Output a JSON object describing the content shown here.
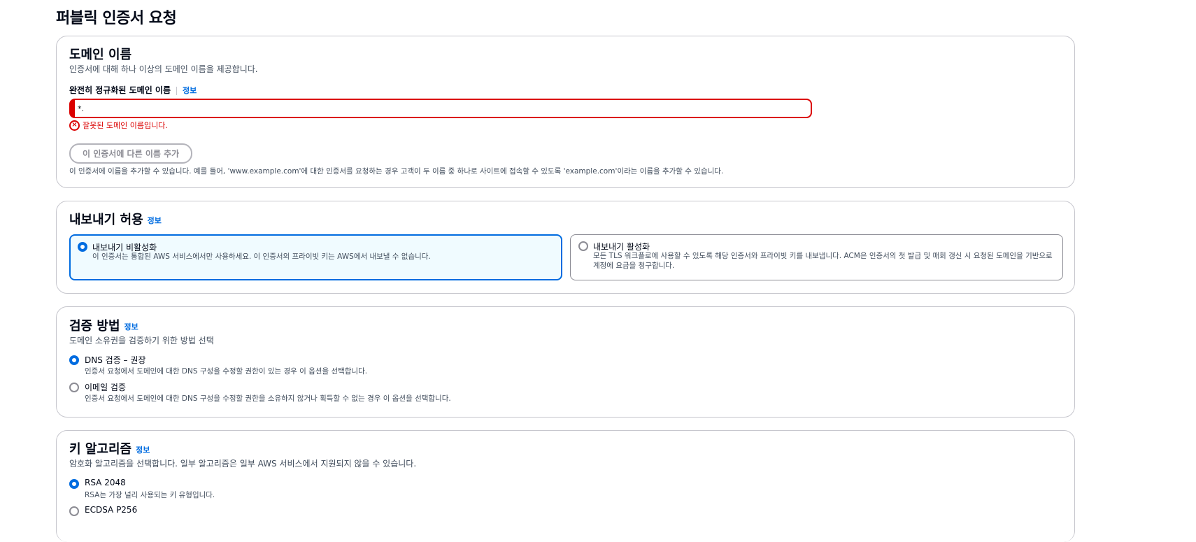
{
  "page_title": "퍼블릭 인증서 요청",
  "domain_section": {
    "heading": "도메인 이름",
    "description": "인증서에 대해 하나 이상의 도메인 이름을 제공합니다.",
    "field_label": "완전히 정규화된 도메인 이름",
    "info_link": "정보",
    "input_value": "*.",
    "error_text": "잘못된 도메인 이름입니다.",
    "add_button": "이 인증서에 다른 이름 추가",
    "help_text": "이 인증서에 이름을 추가할 수 있습니다. 예를 들어, 'www.example.com'에 대한 인증서를 요청하는 경우 고객이 두 이름 중 하나로 사이트에 접속할 수 있도록 'example.com'이라는 이름을 추가할 수 있습니다."
  },
  "export_section": {
    "heading": "내보내기 허용",
    "info_link": "정보",
    "options": [
      {
        "title": "내보내기 비활성화",
        "description": "이 인증서는 통합된 AWS 서비스에서만 사용하세요. 이 인증서의 프라이빗 키는 AWS에서 내보낼 수 없습니다.",
        "selected": true
      },
      {
        "title": "내보내기 활성화",
        "description": "모든 TLS 워크플로에 사용할 수 있도록 해당 인증서와 프라이빗 키를 내보냅니다. ACM은 인증서의 첫 발급 및 매회 갱신 시 요청된 도메인을 기반으로 계정에 요금을 청구합니다.",
        "selected": false
      }
    ]
  },
  "validation_section": {
    "heading": "검증 방법",
    "info_link": "정보",
    "description": "도메인 소유권을 검증하기 위한 방법 선택",
    "options": [
      {
        "title": "DNS 검증 – 권장",
        "description": "인증서 요청에서 도메인에 대한 DNS 구성을 수정할 권한이 있는 경우 이 옵션을 선택합니다.",
        "selected": true
      },
      {
        "title": "이메일 검증",
        "description": "인증서 요청에서 도메인에 대한 DNS 구성을 수정할 권한을 소유하지 않거나 획득할 수 없는 경우 이 옵션을 선택합니다.",
        "selected": false
      }
    ]
  },
  "key_section": {
    "heading": "키 알고리즘",
    "info_link": "정보",
    "description": "암호화 알고리즘을 선택합니다. 일부 알고리즘은 일부 AWS 서비스에서 지원되지 않을 수 있습니다.",
    "options": [
      {
        "title": "RSA 2048",
        "description": "RSA는 가장 널리 사용되는 키 유형입니다.",
        "selected": true
      },
      {
        "title": "ECDSA P256",
        "description": "",
        "selected": false
      }
    ]
  },
  "colors": {
    "accent": "#006ce0",
    "error": "#db0000",
    "border": "#c6c6cd"
  }
}
